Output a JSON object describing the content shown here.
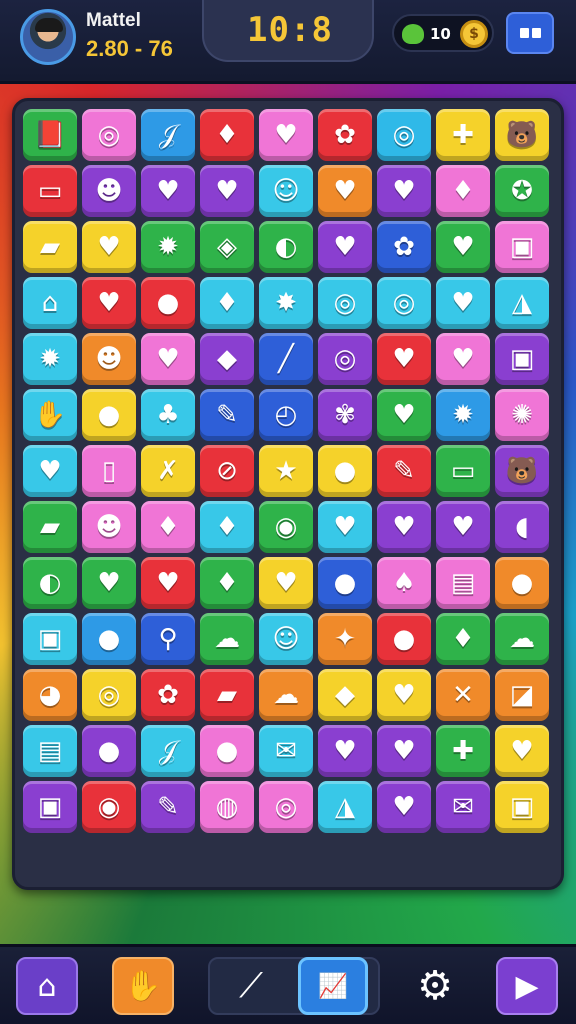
{
  "header": {
    "player_name": "Mattel",
    "player_score": "2.80 - 76",
    "timer": "10:8",
    "gem_count": "10",
    "coin_symbol": "$"
  },
  "board": {
    "rows": [
      [
        {
          "c": "#2fb34a",
          "g": "📕"
        },
        {
          "c": "#f075d6",
          "g": "◎"
        },
        {
          "c": "#2e9ae6",
          "g": "𝒥"
        },
        {
          "c": "#e8323a",
          "g": "♦"
        },
        {
          "c": "#f075d6",
          "g": "♥"
        },
        {
          "c": "#e8323a",
          "g": "✿"
        },
        {
          "c": "#2fb9e8",
          "g": "◎"
        },
        {
          "c": "#f5d22a",
          "g": "✚"
        },
        {
          "c": "#f5d22a",
          "g": "🐻"
        }
      ],
      [
        {
          "c": "#e8323a",
          "g": "▭"
        },
        {
          "c": "#8a3fd0",
          "g": "☻"
        },
        {
          "c": "#8a3fd0",
          "g": "♥"
        },
        {
          "c": "#8a3fd0",
          "g": "♥"
        },
        {
          "c": "#38c8e8",
          "g": "☺"
        },
        {
          "c": "#f08a2a",
          "g": "♥"
        },
        {
          "c": "#8a3fd0",
          "g": "♥"
        },
        {
          "c": "#f075d6",
          "g": "♦"
        },
        {
          "c": "#2fb34a",
          "g": "✪"
        }
      ],
      [
        {
          "c": "#f5d22a",
          "g": "▰"
        },
        {
          "c": "#f5d22a",
          "g": "♥"
        },
        {
          "c": "#2fb34a",
          "g": "✹"
        },
        {
          "c": "#2fb34a",
          "g": "◈"
        },
        {
          "c": "#2fb34a",
          "g": "◐"
        },
        {
          "c": "#8a3fd0",
          "g": "♥"
        },
        {
          "c": "#2e5fd8",
          "g": "✿"
        },
        {
          "c": "#2fb34a",
          "g": "♥"
        },
        {
          "c": "#f075d6",
          "g": "▣"
        }
      ],
      [
        {
          "c": "#38c8e8",
          "g": "⌂"
        },
        {
          "c": "#e8323a",
          "g": "♥"
        },
        {
          "c": "#e8323a",
          "g": "●"
        },
        {
          "c": "#38c8e8",
          "g": "♦"
        },
        {
          "c": "#38c8e8",
          "g": "✸"
        },
        {
          "c": "#38c8e8",
          "g": "◎"
        },
        {
          "c": "#38c8e8",
          "g": "◎"
        },
        {
          "c": "#38c8e8",
          "g": "♥"
        },
        {
          "c": "#38c8e8",
          "g": "◮"
        }
      ],
      [
        {
          "c": "#38c8e8",
          "g": "✹"
        },
        {
          "c": "#f08a2a",
          "g": "☻"
        },
        {
          "c": "#f075d6",
          "g": "♥"
        },
        {
          "c": "#8a3fd0",
          "g": "◆"
        },
        {
          "c": "#2e5fd8",
          "g": "╱"
        },
        {
          "c": "#8a3fd0",
          "g": "◎"
        },
        {
          "c": "#e8323a",
          "g": "♥"
        },
        {
          "c": "#f075d6",
          "g": "♥"
        },
        {
          "c": "#8a3fd0",
          "g": "▣"
        }
      ],
      [
        {
          "c": "#38c8e8",
          "g": "✋"
        },
        {
          "c": "#f5d22a",
          "g": "●"
        },
        {
          "c": "#38c8e8",
          "g": "♣"
        },
        {
          "c": "#2e5fd8",
          "g": "✎"
        },
        {
          "c": "#2e5fd8",
          "g": "◴"
        },
        {
          "c": "#8a3fd0",
          "g": "✾"
        },
        {
          "c": "#2fb34a",
          "g": "♥"
        },
        {
          "c": "#2e9ae6",
          "g": "✹"
        },
        {
          "c": "#f075d6",
          "g": "✺"
        }
      ],
      [
        {
          "c": "#38c8e8",
          "g": "♥"
        },
        {
          "c": "#f075d6",
          "g": "▯"
        },
        {
          "c": "#f5d22a",
          "g": "✗"
        },
        {
          "c": "#e8323a",
          "g": "⊘"
        },
        {
          "c": "#f5d22a",
          "g": "★"
        },
        {
          "c": "#f5d22a",
          "g": "●"
        },
        {
          "c": "#e8323a",
          "g": "✎"
        },
        {
          "c": "#2fb34a",
          "g": "▭"
        },
        {
          "c": "#8a3fd0",
          "g": "🐻"
        }
      ],
      [
        {
          "c": "#2fb34a",
          "g": "▰"
        },
        {
          "c": "#f075d6",
          "g": "☻"
        },
        {
          "c": "#f075d6",
          "g": "♦"
        },
        {
          "c": "#38c8e8",
          "g": "♦"
        },
        {
          "c": "#2fb34a",
          "g": "◉"
        },
        {
          "c": "#38c8e8",
          "g": "♥"
        },
        {
          "c": "#8a3fd0",
          "g": "♥"
        },
        {
          "c": "#8a3fd0",
          "g": "♥"
        },
        {
          "c": "#8a3fd0",
          "g": "◖"
        }
      ],
      [
        {
          "c": "#2fb34a",
          "g": "◐"
        },
        {
          "c": "#2fb34a",
          "g": "♥"
        },
        {
          "c": "#e8323a",
          "g": "♥"
        },
        {
          "c": "#2fb34a",
          "g": "♦"
        },
        {
          "c": "#f5d22a",
          "g": "♥"
        },
        {
          "c": "#2e5fd8",
          "g": "●"
        },
        {
          "c": "#f075d6",
          "g": "♠"
        },
        {
          "c": "#f075d6",
          "g": "▤"
        },
        {
          "c": "#f08a2a",
          "g": "●"
        }
      ],
      [
        {
          "c": "#38c8e8",
          "g": "▣"
        },
        {
          "c": "#2e9ae6",
          "g": "●"
        },
        {
          "c": "#2e5fd8",
          "g": "⚲"
        },
        {
          "c": "#2fb34a",
          "g": "☁"
        },
        {
          "c": "#38c8e8",
          "g": "☺"
        },
        {
          "c": "#f08a2a",
          "g": "✦"
        },
        {
          "c": "#e8323a",
          "g": "●"
        },
        {
          "c": "#2fb34a",
          "g": "♦"
        },
        {
          "c": "#2fb34a",
          "g": "☁"
        }
      ],
      [
        {
          "c": "#f08a2a",
          "g": "◕"
        },
        {
          "c": "#f5d22a",
          "g": "◎"
        },
        {
          "c": "#e8323a",
          "g": "✿"
        },
        {
          "c": "#e8323a",
          "g": "▰"
        },
        {
          "c": "#f08a2a",
          "g": "☁"
        },
        {
          "c": "#f5d22a",
          "g": "◆"
        },
        {
          "c": "#f5d22a",
          "g": "♥"
        },
        {
          "c": "#f08a2a",
          "g": "✕"
        },
        {
          "c": "#f08a2a",
          "g": "◪"
        }
      ],
      [
        {
          "c": "#38c8e8",
          "g": "▤"
        },
        {
          "c": "#8a3fd0",
          "g": "●"
        },
        {
          "c": "#38c8e8",
          "g": "𝒥"
        },
        {
          "c": "#f075d6",
          "g": "●"
        },
        {
          "c": "#38c8e8",
          "g": "✉"
        },
        {
          "c": "#8a3fd0",
          "g": "♥"
        },
        {
          "c": "#8a3fd0",
          "g": "♥"
        },
        {
          "c": "#2fb34a",
          "g": "✚"
        },
        {
          "c": "#f5d22a",
          "g": "♥"
        }
      ],
      [
        {
          "c": "#8a3fd0",
          "g": "▣"
        },
        {
          "c": "#e8323a",
          "g": "◉"
        },
        {
          "c": "#8a3fd0",
          "g": "✎"
        },
        {
          "c": "#f075d6",
          "g": "◍"
        },
        {
          "c": "#f075d6",
          "g": "◎"
        },
        {
          "c": "#38c8e8",
          "g": "◮"
        },
        {
          "c": "#8a3fd0",
          "g": "♥"
        },
        {
          "c": "#8a3fd0",
          "g": "✉"
        },
        {
          "c": "#f5d22a",
          "g": "▣"
        }
      ]
    ]
  },
  "toolbar": {
    "home_icon": "⌂",
    "hand_icon": "✋",
    "tool_icon": "⟋",
    "chart_icon": "📈",
    "gear_icon": "⚙",
    "next_icon": "▶"
  }
}
